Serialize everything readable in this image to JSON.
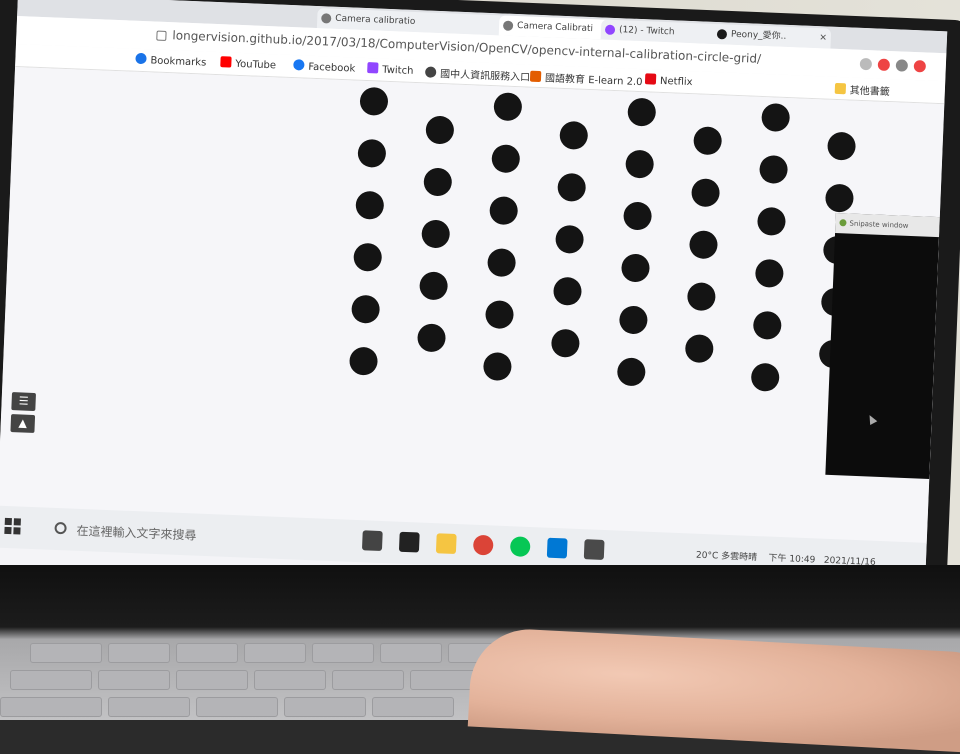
{
  "browser": {
    "tabs": [
      {
        "label": "Camera calibratio",
        "active": false
      },
      {
        "label": "Camera Calibrati",
        "active": true
      },
      {
        "label": "(12) - Twitch",
        "active": false
      },
      {
        "label": "Peony_愛你..",
        "active": false
      }
    ],
    "url": "longervision.github.io/2017/03/18/ComputerVision/OpenCV/opencv-internal-calibration-circle-grid/",
    "bookmarks": [
      {
        "label": "Bookmarks",
        "icon": "star-icon",
        "color": "#1a73e8"
      },
      {
        "label": "YouTube",
        "icon": "youtube-icon",
        "color": "#ff0000"
      },
      {
        "label": "Facebook",
        "icon": "facebook-icon",
        "color": "#1877f2"
      },
      {
        "label": "Twitch",
        "icon": "twitch-icon",
        "color": "#9146ff"
      },
      {
        "label": "國中人資訊服務入口",
        "icon": "pin-icon",
        "color": "#444444"
      },
      {
        "label": "國語教育 E-learn 2.0",
        "icon": "book-icon",
        "color": "#e35d00"
      },
      {
        "label": "Netflix",
        "icon": "netflix-icon",
        "color": "#e50914"
      },
      {
        "label": "其他書籤",
        "icon": "folder-icon",
        "color": "#f5c542"
      }
    ]
  },
  "page": {
    "pattern": "asymmetric-circle-grid",
    "dot_color": "#141414",
    "rows": 11,
    "cols": 4
  },
  "side_panel": {
    "title": "Snipaste window"
  },
  "taskbar": {
    "search_placeholder": "在這裡輸入文字來搜尋",
    "pinned": [
      {
        "name": "task-view-icon",
        "color": "#444444"
      },
      {
        "name": "shield-app-icon",
        "color": "#222222"
      },
      {
        "name": "file-explorer-icon",
        "color": "#f5c542"
      },
      {
        "name": "chrome-icon",
        "color": "#db4437"
      },
      {
        "name": "line-icon",
        "color": "#06c755"
      },
      {
        "name": "vscode-icon",
        "color": "#0078d4"
      },
      {
        "name": "photos-icon",
        "color": "#4a4a4a"
      }
    ],
    "tray": {
      "weather": "20°C 多雲時晴",
      "time": "下午 10:49",
      "date": "2021/11/16"
    }
  },
  "colors": {
    "screen_bg": "#f6f6f9",
    "taskbar_bg": "#eceef1"
  }
}
